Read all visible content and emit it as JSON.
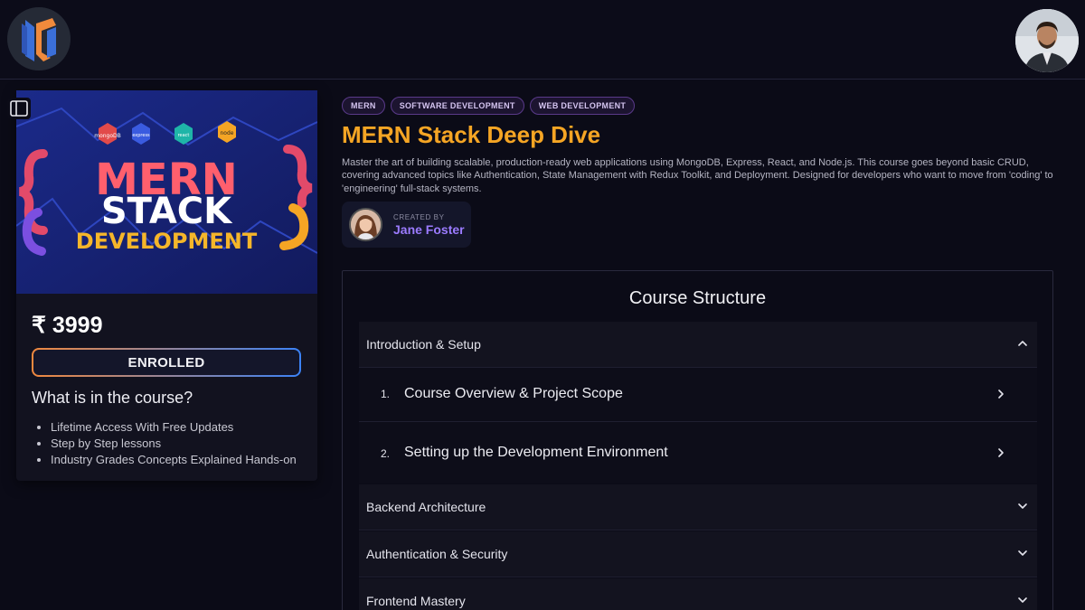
{
  "header": {
    "logo_icon": "lc-logo-icon",
    "profile_avatar_icon": "user-avatar"
  },
  "sidebar_toggle_icon": "sidebar-panel-icon",
  "course_card": {
    "thumbnail": {
      "tech_badges": [
        "mongoDB",
        "express",
        "react",
        "node"
      ],
      "line1": "MERN",
      "line2": "STACK",
      "line3": "DEVELOPMENT"
    },
    "price": "₹ 3999",
    "enroll_label": "ENROLLED",
    "whats_title": "What is in the course?",
    "features": [
      "Lifetime Access With Free Updates",
      "Step by Step lessons",
      "Industry Grades Concepts Explained Hands-on"
    ]
  },
  "course": {
    "tags": [
      "MERN",
      "SOFTWARE DEVELOPMENT",
      "WEB DEVELOPMENT"
    ],
    "title": "MERN Stack Deep Dive",
    "description": "Master the art of building scalable, production-ready web applications using MongoDB, Express, React, and Node.js. This course goes beyond basic CRUD, covering advanced topics like Authentication, State Management with Redux Toolkit, and Deployment. Designed for developers who want to move from 'coding' to 'engineering' full-stack systems.",
    "creator_label": "CREATED BY",
    "creator_name": "Jane Foster"
  },
  "structure": {
    "title": "Course Structure",
    "sections": [
      {
        "name": "Introduction & Setup",
        "expanded": true,
        "lessons": [
          {
            "num": "1.",
            "name": "Course Overview & Project Scope"
          },
          {
            "num": "2.",
            "name": "Setting up the Development Environment"
          }
        ]
      },
      {
        "name": "Backend Architecture",
        "expanded": false
      },
      {
        "name": "Authentication & Security",
        "expanded": false
      },
      {
        "name": "Frontend Mastery",
        "expanded": false
      }
    ]
  },
  "colors": {
    "accent_title": "#f5a524",
    "creator_name": "#9b7bff",
    "background": "#0b0b17"
  }
}
